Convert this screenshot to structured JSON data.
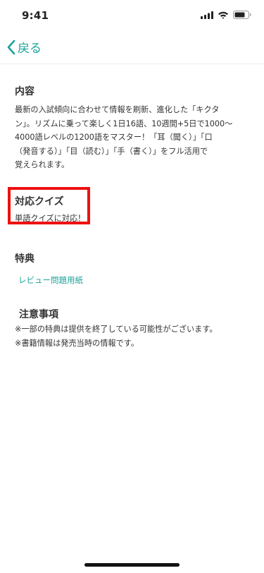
{
  "colors": {
    "accent": "#1aa39a",
    "highlight": "#ee1111"
  },
  "status_bar": {
    "time": "9:41",
    "icons": [
      "cellular-signal-icon",
      "wifi-icon",
      "battery-icon"
    ]
  },
  "nav": {
    "back_label": "戻る",
    "back_icon": "chevron-left-icon"
  },
  "content": {
    "title": "内容",
    "lines": [
      "最新の入試傾向に合わせて情報を刷新、進化した「キクタ",
      "ン」。リズムに乗って楽しく1日16語、10週間+5日で1000〜",
      "4000語レベルの1200語をマスター！「耳（聞く）」「口",
      "（発音する）」「目（読む）」「手（書く）」をフル活用で",
      "覚えられます。"
    ]
  },
  "quiz": {
    "title": "対応クイズ",
    "text": "単語クイズに対応！"
  },
  "bonus": {
    "title": "特典",
    "link": "レビュー問題用紙"
  },
  "notes": {
    "title": "注意事項",
    "lines": [
      "※一部の特典は提供を終了している可能性がございます。",
      "※書籍情報は発売当時の情報です。"
    ]
  }
}
